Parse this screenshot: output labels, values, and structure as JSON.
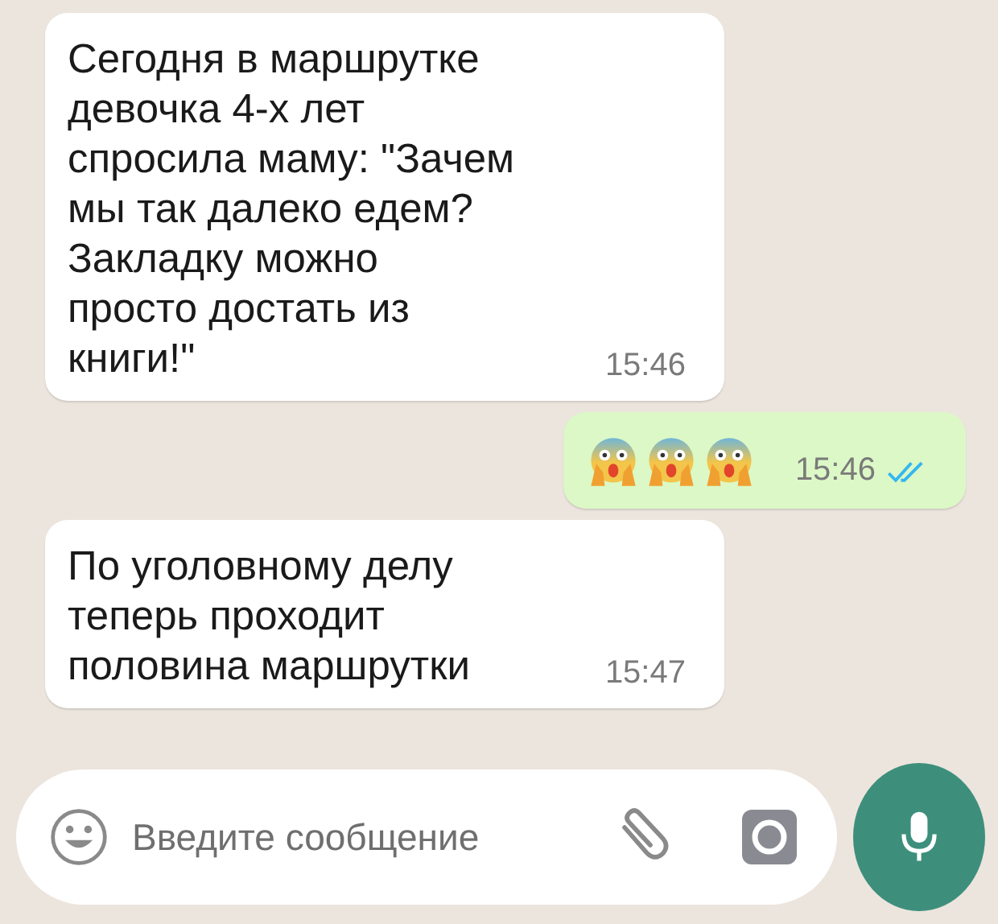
{
  "messages": [
    {
      "outgoing": false,
      "kind": "text",
      "text": "Сегодня в маршрутке\nдевочка 4-х лет\nспросила маму: \"Зачем\nмы так далеко едем?\nЗакладку можно\nпросто достать из\nкниги!\"",
      "time": "15:46"
    },
    {
      "outgoing": true,
      "kind": "emoji",
      "time": "15:46",
      "read": true
    },
    {
      "outgoing": false,
      "kind": "text",
      "text": "По уголовному делу\nтеперь проходит\nполовина маршрутки",
      "time": "15:47"
    }
  ],
  "composer": {
    "placeholder": "Введите сообщение"
  }
}
